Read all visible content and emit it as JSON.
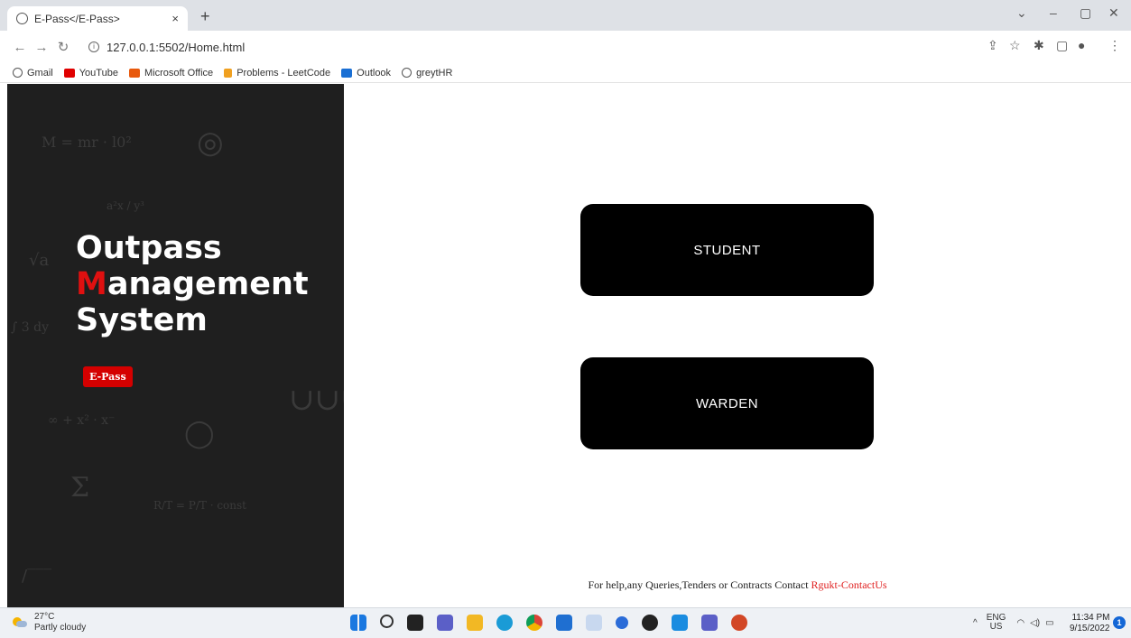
{
  "browser": {
    "tab_title": "E-Pass</E-Pass>",
    "tab_close": "×",
    "new_tab": "+",
    "url": "127.0.0.1:5502/Home.html",
    "bookmarks": [
      {
        "label": "Gmail",
        "icon": "globe-icon",
        "color": "#555555"
      },
      {
        "label": "YouTube",
        "icon": "youtube-icon",
        "color": "#e00000"
      },
      {
        "label": "Microsoft Office",
        "icon": "office-icon",
        "color": "#e8590c"
      },
      {
        "label": "Problems - LeetCode",
        "icon": "leetcode-icon",
        "color": "#f0a020"
      },
      {
        "label": "Outlook",
        "icon": "outlook-icon",
        "color": "#1a6fd4"
      },
      {
        "label": "greytHR",
        "icon": "globe-icon",
        "color": "#555555"
      }
    ]
  },
  "sidebar": {
    "title_line1": "Outpass",
    "title_line2_red": "M",
    "title_line2_rest": "anagement",
    "title_line3": "System",
    "badge": "E-Pass"
  },
  "main": {
    "student_button": "STUDENT",
    "warden_button": "WARDEN",
    "footer_text": "For help,any Queries,Tenders or Contracts Contact ",
    "footer_link": "Rgukt-ContactUs"
  },
  "taskbar": {
    "temperature": "27°C",
    "weather": "Partly cloudy",
    "lang_top": "ENG",
    "lang_bottom": "US",
    "time": "11:34 PM",
    "date": "9/15/2022",
    "notifications": "1"
  },
  "colors": {
    "accent_red": "#e01010",
    "panel_bg": "#1f1f1f",
    "button_bg": "#000000"
  }
}
